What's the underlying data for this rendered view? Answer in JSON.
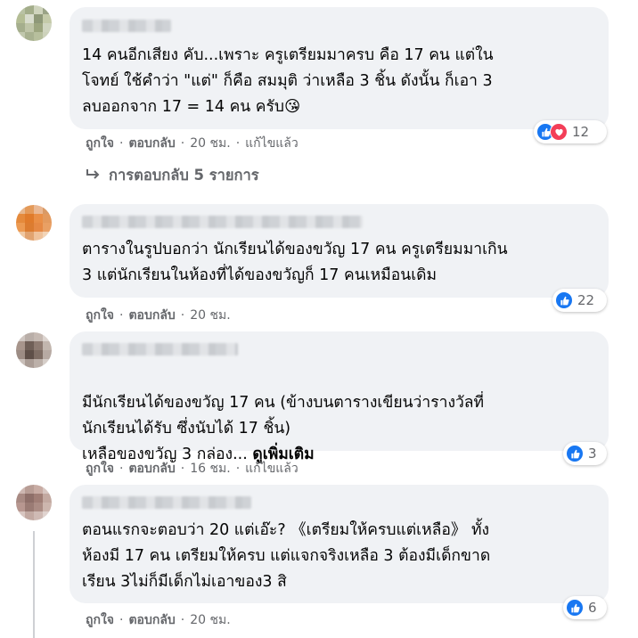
{
  "comments": [
    {
      "text": "14 คนอีกเสียง คับ...เพราะ ครูเตรียมมาครบ คือ 17 คน แต่ใน\nโจทย์ ใช้คำว่า \"แต่\" ก็คือ สมมุติ ว่าเหลือ 3 ชิ้น ดังนั้น ก็เอา 3\nลบออกจาก 17 = 14 คน ครับ😘",
      "reaction_count": "12",
      "reactions": [
        "like",
        "love"
      ],
      "like_label": "ถูกใจ",
      "reply_label": "ตอบกลับ",
      "time": "20 ชม.",
      "edited": "แก้ไขแล้ว"
    },
    {
      "text": "ตารางในรูปบอกว่า นักเรียนได้ของขวัญ 17 คน ครูเตรียมมาเกิน\n3 แต่นักเรียนในห้องที่ได้ของขวัญก็ 17 คนเหมือนเดิม",
      "reaction_count": "22",
      "reactions": [
        "like"
      ],
      "like_label": "ถูกใจ",
      "reply_label": "ตอบกลับ",
      "time": "20 ชม."
    },
    {
      "text": "มีนักเรียนได้ของขวัญ 17 คน (ข้างบนตารางเขียนว่ารางวัลที่\nนักเรียนได้รับ ซึ่งนับได้ 17 ชิ้น)\nเหลือของขวัญ 3 กล่อง... ",
      "see_more": "ดูเพิ่มเติม",
      "reaction_count": "3",
      "reactions": [
        "like"
      ],
      "like_label": "ถูกใจ",
      "reply_label": "ตอบกลับ",
      "time": "16 ชม.",
      "edited": "แก้ไขแล้ว"
    },
    {
      "text": "ตอนแรกจะตอบว่า 20 แต่เอ๊ะ? 《เตรียมให้ครบแต่เหลือ》 ทั้ง\nห้องมี 17 คน เตรียมให้ครบ แต่แจกจริงเหลือ 3 ต้องมีเด็กขาด\nเรียน 3ไม่ก็มีเด็กไม่เอาของ3 สิ",
      "reaction_count": "6",
      "reactions": [
        "like"
      ],
      "like_label": "ถูกใจ",
      "reply_label": "ตอบกลับ",
      "time": "20 ชม."
    }
  ],
  "replies_link": "การตอบกลับ 5 รายการ",
  "colors": {
    "bubble": "#f0f2f5",
    "like": "#1877f2",
    "love": "#f33e58",
    "meta": "#65676b"
  }
}
